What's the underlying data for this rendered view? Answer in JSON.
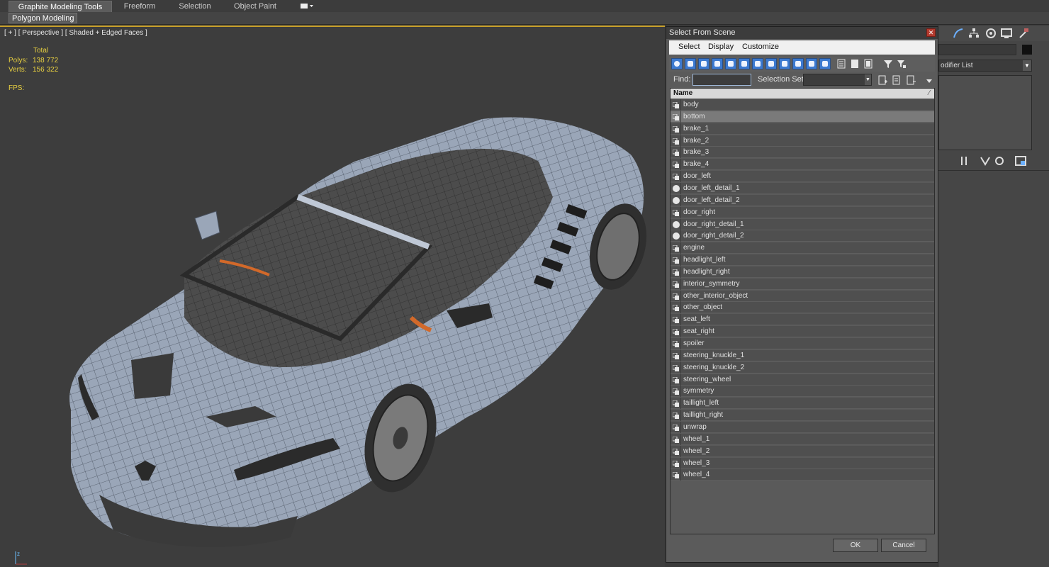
{
  "ribbon": {
    "tabs": [
      {
        "label": "Graphite Modeling Tools",
        "active": true
      },
      {
        "label": "Freeform",
        "active": false
      },
      {
        "label": "Selection",
        "active": false
      },
      {
        "label": "Object Paint",
        "active": false
      }
    ],
    "dropdown_icon": "display-options-icon",
    "subtab": "Polygon Modeling"
  },
  "viewport": {
    "label": "[ + ] [ Perspective ] [ Shaded + Edged Faces ]",
    "stats": {
      "total_label": "Total",
      "polys_label": "Polys:",
      "polys_value": "138 772",
      "verts_label": "Verts:",
      "verts_value": "156 322",
      "fps_label": "FPS:"
    },
    "colors": {
      "stats_text": "#e8d040",
      "active_border": "#c8a02a",
      "background": "#3d3d3d"
    }
  },
  "command_panel": {
    "modifier_list_label": "odifier List"
  },
  "dialog": {
    "title": "Select From Scene",
    "menu": [
      "Select",
      "Display",
      "Customize"
    ],
    "find_label": "Find:",
    "find_value": "",
    "selection_set_label": "Selection Set:",
    "list_header": "Name",
    "items": [
      {
        "name": "body",
        "icon": "group-icon",
        "selected": false
      },
      {
        "name": "bottom",
        "icon": "group-icon",
        "selected": true
      },
      {
        "name": "brake_1",
        "icon": "group-icon",
        "selected": false
      },
      {
        "name": "brake_2",
        "icon": "group-icon",
        "selected": false
      },
      {
        "name": "brake_3",
        "icon": "group-icon",
        "selected": false
      },
      {
        "name": "brake_4",
        "icon": "group-icon",
        "selected": false
      },
      {
        "name": "door_left",
        "icon": "group-icon",
        "selected": false
      },
      {
        "name": "door_left_detail_1",
        "icon": "geometry-icon",
        "selected": false
      },
      {
        "name": "door_left_detail_2",
        "icon": "geometry-icon",
        "selected": false
      },
      {
        "name": "door_right",
        "icon": "group-icon",
        "selected": false
      },
      {
        "name": "door_right_detail_1",
        "icon": "geometry-icon",
        "selected": false
      },
      {
        "name": "door_right_detail_2",
        "icon": "geometry-icon",
        "selected": false
      },
      {
        "name": "engine",
        "icon": "group-icon",
        "selected": false
      },
      {
        "name": "headlight_left",
        "icon": "group-icon",
        "selected": false
      },
      {
        "name": "headlight_right",
        "icon": "group-icon",
        "selected": false
      },
      {
        "name": "interior_symmetry",
        "icon": "group-icon",
        "selected": false
      },
      {
        "name": "other_interior_object",
        "icon": "group-icon",
        "selected": false
      },
      {
        "name": "other_object",
        "icon": "group-icon",
        "selected": false
      },
      {
        "name": "seat_left",
        "icon": "group-icon",
        "selected": false
      },
      {
        "name": "seat_right",
        "icon": "group-icon",
        "selected": false
      },
      {
        "name": "spoiler",
        "icon": "group-icon",
        "selected": false
      },
      {
        "name": "steering_knuckle_1",
        "icon": "group-icon",
        "selected": false
      },
      {
        "name": "steering_knuckle_2",
        "icon": "group-icon",
        "selected": false
      },
      {
        "name": "steering_wheel",
        "icon": "group-icon",
        "selected": false
      },
      {
        "name": "symmetry",
        "icon": "group-icon",
        "selected": false
      },
      {
        "name": "taillight_left",
        "icon": "group-icon",
        "selected": false
      },
      {
        "name": "taillight_right",
        "icon": "group-icon",
        "selected": false
      },
      {
        "name": "unwrap",
        "icon": "group-icon",
        "selected": false
      },
      {
        "name": "wheel_1",
        "icon": "group-icon",
        "selected": false
      },
      {
        "name": "wheel_2",
        "icon": "group-icon",
        "selected": false
      },
      {
        "name": "wheel_3",
        "icon": "group-icon",
        "selected": false
      },
      {
        "name": "wheel_4",
        "icon": "group-icon",
        "selected": false
      }
    ],
    "ok_label": "OK",
    "cancel_label": "Cancel",
    "colors": {
      "toolbar_active": "#3d7ad0",
      "selected_row": "#7a7a7a",
      "close": "#b33a2e"
    }
  }
}
